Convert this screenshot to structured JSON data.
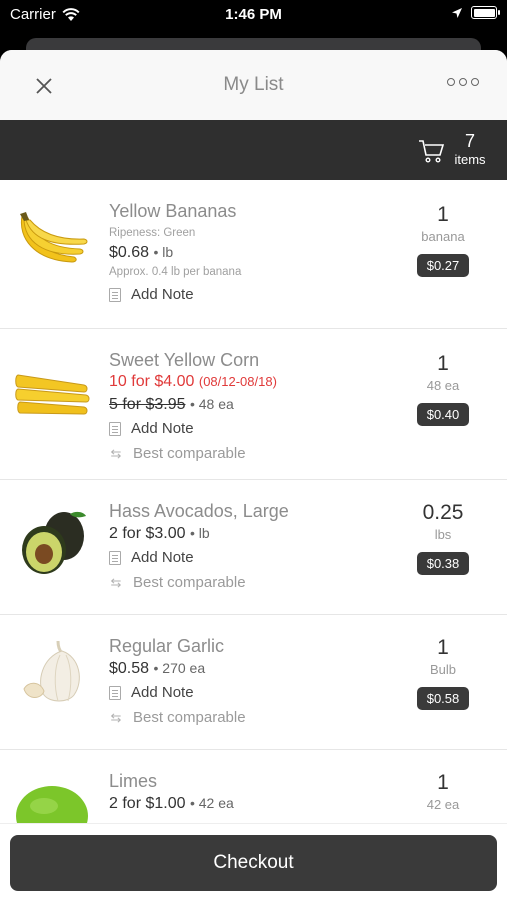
{
  "status_bar": {
    "carrier": "Carrier",
    "time": "1:46 PM"
  },
  "nav": {
    "title": "My List"
  },
  "cart": {
    "count": "7",
    "label": "items"
  },
  "items": [
    {
      "name": "Yellow Bananas",
      "ripeness": "Ripeness: Green",
      "price": "$0.68",
      "price_unit": "lb",
      "approx": "Approx. 0.4 lb per banana",
      "note_label": "Add Note",
      "qty": "1",
      "qty_unit": "banana",
      "total": "$0.27",
      "image_icon": "banana-icon"
    },
    {
      "name": "Sweet Yellow Corn",
      "promo_price": "10 for $4.00",
      "promo_dates": "(08/12-08/18)",
      "old_price": "5 for $3.95",
      "price_unit": "48 ea",
      "note_label": "Add Note",
      "compare_label": "Best comparable",
      "qty": "1",
      "qty_unit": "48 ea",
      "total": "$0.40",
      "image_icon": "corn-icon"
    },
    {
      "name": "Hass Avocados, Large",
      "price": "2 for $3.00",
      "price_unit": "lb",
      "note_label": "Add Note",
      "compare_label": "Best comparable",
      "qty": "0.25",
      "qty_unit": "lbs",
      "total": "$0.38",
      "image_icon": "avocado-icon"
    },
    {
      "name": "Regular Garlic",
      "price": "$0.58",
      "price_unit": "270 ea",
      "note_label": "Add Note",
      "compare_label": "Best comparable",
      "qty": "1",
      "qty_unit": "Bulb",
      "total": "$0.58",
      "image_icon": "garlic-icon"
    },
    {
      "name": "Limes",
      "price": "2 for $1.00",
      "price_unit": "42 ea",
      "qty": "1",
      "qty_unit": "42 ea",
      "image_icon": "lime-icon"
    }
  ],
  "checkout": {
    "label": "Checkout"
  },
  "colors": {
    "dark": "#3a3a3a",
    "promo": "#e03a3a",
    "muted": "#8c8c8c"
  }
}
